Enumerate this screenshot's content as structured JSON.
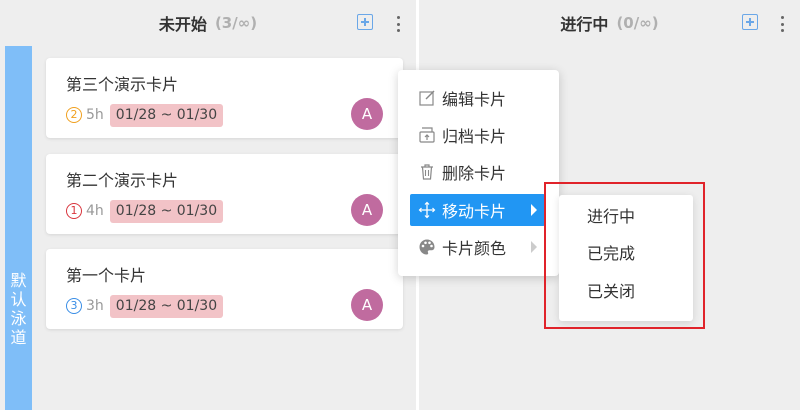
{
  "columns": [
    {
      "title": "未开始",
      "count": "(3/∞)"
    },
    {
      "title": "进行中",
      "count": "(0/∞)"
    }
  ],
  "lane": {
    "label_chars": [
      "默",
      "认",
      "泳",
      "道"
    ],
    "color": "#7fbef8"
  },
  "cards": [
    {
      "title": "第三个演示卡片",
      "priority": "2",
      "priority_color": "#f0a020",
      "estimate": "5h",
      "date_range": "01/28 ~ 01/30",
      "avatar": "A"
    },
    {
      "title": "第二个演示卡片",
      "priority": "1",
      "priority_color": "#d9363e",
      "estimate": "4h",
      "date_range": "01/28 ~ 01/30",
      "avatar": "A"
    },
    {
      "title": "第一个卡片",
      "priority": "3",
      "priority_color": "#3a8ee6",
      "estimate": "3h",
      "date_range": "01/28 ~ 01/30",
      "avatar": "A"
    }
  ],
  "context_menu": {
    "items": [
      {
        "label": "编辑卡片",
        "icon": "edit-icon"
      },
      {
        "label": "归档卡片",
        "icon": "archive-icon"
      },
      {
        "label": "删除卡片",
        "icon": "trash-icon"
      },
      {
        "label": "移动卡片",
        "icon": "move-icon",
        "active": true
      },
      {
        "label": "卡片颜色",
        "icon": "palette-icon"
      }
    ],
    "submenu": [
      "进行中",
      "已完成",
      "已关闭"
    ]
  },
  "colors": {
    "accent": "#2196f3",
    "highlight_border": "#e0232a",
    "date_badge": "#f2c3c7",
    "avatar": "#c06b9f"
  }
}
